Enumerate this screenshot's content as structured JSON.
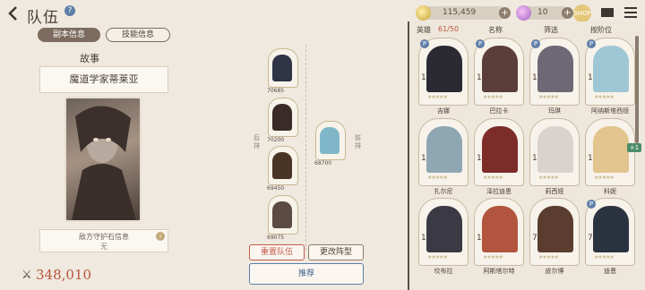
{
  "header": {
    "title": "队伍",
    "help": "?",
    "gold": "115,459",
    "gems": "10",
    "shop": "SHOP"
  },
  "left_panel": {
    "tabs": [
      "副本信息",
      "技能信息"
    ],
    "story_title": "故事",
    "story_name": "魔道学家蒂莱亚",
    "guardian_label": "敌方守护石信息",
    "guardian_value": "无",
    "guardian_info": "i",
    "power_icon": "⚔",
    "power": "348,010"
  },
  "formation": {
    "back_label": "后排",
    "front_label": "前排",
    "slots": [
      {
        "power": "70685",
        "color": "#2f3446"
      },
      {
        "power": "70200",
        "color": "#3a2a28"
      },
      {
        "power": "69450",
        "color": "#4a3426"
      },
      {
        "power": "69075",
        "color": "#5c4b42"
      },
      {
        "power": "68700",
        "color": "#7fb7c8"
      }
    ],
    "reset_label": "重置队伍",
    "change_label": "更改阵型",
    "recommend_label": "推荐"
  },
  "hero_list": {
    "columns": [
      "英雄",
      "61/50",
      "名称",
      "筛选",
      "按阶位"
    ],
    "heroes": [
      {
        "name": "吉娜",
        "badge": "P",
        "color": "#2b2a33"
      },
      {
        "name": "巴拉卡",
        "badge": "P",
        "color": "#5b3d3a"
      },
      {
        "name": "玛琪",
        "badge": "P",
        "color": "#6d6874"
      },
      {
        "name": "阿纳斯塔西娅",
        "badge": "P",
        "color": "#9fc6d4"
      },
      {
        "name": "扎尔尼",
        "badge": "",
        "color": "#8fa7b2"
      },
      {
        "name": "泽拉迪恩",
        "badge": "",
        "color": "#7c2d2a"
      },
      {
        "name": "莉西娅",
        "badge": "",
        "color": "#d8d3cf"
      },
      {
        "name": "科妮",
        "badge": "",
        "color": "#e2c48f"
      },
      {
        "name": "坎布拉",
        "badge": "",
        "color": "#3b3a44"
      },
      {
        "name": "阿斯塔尔特",
        "badge": "",
        "color": "#b2553e"
      },
      {
        "name": "皮尔博",
        "badge": "",
        "color": "#5a3d2e"
      },
      {
        "name": "迪恩",
        "badge": "P",
        "color": "#2c3340"
      }
    ],
    "level": "1",
    "level_alt": "7",
    "plus_tag": "+1"
  }
}
